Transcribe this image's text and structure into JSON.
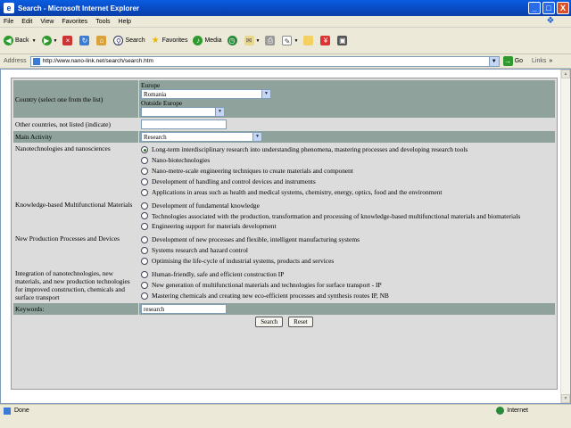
{
  "window": {
    "title": "Search - Microsoft Internet Explorer",
    "buttons": [
      "_",
      "□",
      "X"
    ]
  },
  "menu": [
    "File",
    "Edit",
    "View",
    "Favorites",
    "Tools",
    "Help"
  ],
  "toolbar": {
    "back": "Back",
    "search": "Search",
    "favorites": "Favorites",
    "media": "Media"
  },
  "address": {
    "label": "Address",
    "url": "http://www.nano-link.net/search/search.htm",
    "go": "Go",
    "links": "Links"
  },
  "form": {
    "country": {
      "label": "Country (select one from the list)",
      "europe_label": "Europe",
      "europe_value": "Romania",
      "outside_label": "Outside Europe",
      "outside_value": ""
    },
    "other_countries": {
      "label": "Other countries, not listed (indicate)",
      "value": ""
    },
    "main_activity": {
      "label": "Main Activity",
      "value": "Research"
    },
    "nano": {
      "label": "Nanotechnologies and nanosciences",
      "options": [
        "Long-term interdisciplinary research into understanding phenomena, mastering processes and developing research tools",
        "Nano-biotechnologies",
        "Nano-metre-scale engineering techniques to create materials and component",
        "Development of handling and control devices and instruments",
        "Applications in areas such as health and medical systems, chemistry, energy, optics, food and the environment"
      ]
    },
    "knowledge": {
      "label": "Knowledge-based Multifunctional Materials",
      "options": [
        "Development of fundamental knowledge",
        "Technologies associated with the production, transformation and processing of knowledge-based multifunctional materials and biomaterials",
        "Engineering support for materials development"
      ]
    },
    "production": {
      "label": "New Production Processes and Devices",
      "options": [
        "Development of new processes and flexible, intelligent manufacturing systems",
        "Systems research and hazard control",
        "Optimising the life-cycle of industrial systems, products and services"
      ]
    },
    "integration": {
      "label": "Integration of nanotechnologies, new materials, and new production technologies for improved construction, chemicals and surface transport",
      "options": [
        "Human-friendly, safe and efficient construction IP",
        "New generation of multifunctional materials and technologies for surface transport - IP",
        "Mastering chemicals and creating new eco-efficient processes and synthesis routes IP, NB"
      ]
    },
    "keywords": {
      "label": "Keywords:",
      "value": "research"
    },
    "search_button": "Search",
    "reset_button": "Reset"
  },
  "status": {
    "text": "Done",
    "zone": "Internet"
  }
}
